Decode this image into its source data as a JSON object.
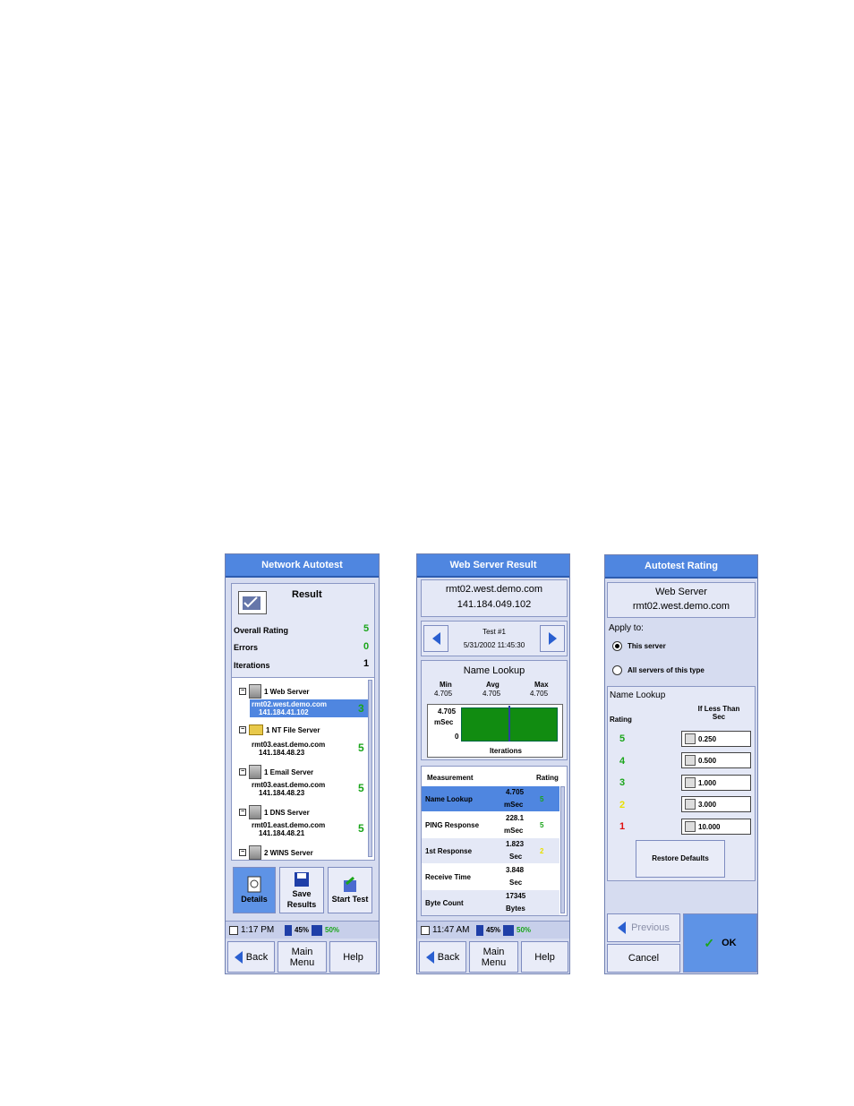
{
  "screen1": {
    "title": "Network Autotest",
    "result_label": "Result",
    "rows": [
      {
        "label": "Overall Rating",
        "value": "5"
      },
      {
        "label": "Errors",
        "value": "0"
      },
      {
        "label": "Iterations",
        "value": "1"
      }
    ],
    "tree": [
      {
        "group": "1 Web Server",
        "host": "rmt02.west.demo.com",
        "ip": "141.184.41.102",
        "rating": "3",
        "selected": true
      },
      {
        "group": "1 NT File Server",
        "host": "rmt03.east.demo.com",
        "ip": "141.184.48.23",
        "rating": "5"
      },
      {
        "group": "1 Email Server",
        "host": "rmt03.east.demo.com",
        "ip": "141.184.48.23",
        "rating": "5"
      },
      {
        "group": "1 DNS Server",
        "host": "rmt01.east.demo.com",
        "ip": "141.184.48.21",
        "rating": "5"
      },
      {
        "group": "2 WINS Server"
      }
    ],
    "buttons": {
      "details": "Details",
      "save": "Save Results",
      "start": "Start Test"
    },
    "status": {
      "time": "1:17 PM",
      "battery": "45%",
      "disk": "50%"
    },
    "nav": {
      "back": "Back",
      "main": "Main Menu",
      "help": "Help"
    }
  },
  "screen2": {
    "title": "Web Server Result",
    "host": "rmt02.west.demo.com",
    "ip": "141.184.049.102",
    "test_label": "Test #1",
    "test_date": "5/31/2002 11:45:30",
    "chart_title": "Name Lookup",
    "stats": [
      {
        "label": "Min",
        "value": "4.705"
      },
      {
        "label": "Avg",
        "value": "4.705"
      },
      {
        "label": "Max",
        "value": "4.705"
      }
    ],
    "y_value": "4.705",
    "y_unit": "mSec",
    "y_zero": "0",
    "x_label": "Iterations",
    "table_header": {
      "measurement": "Measurement",
      "rating": "Rating"
    },
    "measurements": [
      {
        "name": "Name Lookup",
        "value": "4.705",
        "unit": "mSec",
        "rating": "5"
      },
      {
        "name": "PING Response",
        "value": "228.1",
        "unit": "mSec",
        "rating": "5"
      },
      {
        "name": "1st Response",
        "value": "1.823",
        "unit": "Sec",
        "rating": "2"
      },
      {
        "name": "Receive Time",
        "value": "3.848",
        "unit": "Sec",
        "rating": ""
      },
      {
        "name": "Byte Count",
        "value": "17345",
        "unit": "Bytes",
        "rating": ""
      }
    ],
    "status": {
      "time": "11:47 AM",
      "battery": "45%",
      "disk": "50%"
    },
    "nav": {
      "back": "Back",
      "main": "Main Menu",
      "help": "Help"
    }
  },
  "screen3": {
    "title": "Autotest Rating",
    "server": "Web Server",
    "host": "rmt02.west.demo.com",
    "apply_label": "Apply to:",
    "option_this": "This server",
    "option_all": "All servers of this type",
    "section": "Name Lookup",
    "col_rating": "Rating",
    "col_threshold": "If Less Than Sec",
    "ratings": [
      {
        "rating": "5",
        "value": "0.250",
        "color": "#1aa51a"
      },
      {
        "rating": "4",
        "value": "0.500",
        "color": "#1aa51a"
      },
      {
        "rating": "3",
        "value": "1.000",
        "color": "#1aa51a"
      },
      {
        "rating": "2",
        "value": "3.000",
        "color": "#e8e000"
      },
      {
        "rating": "1",
        "value": "10.000",
        "color": "#e01010"
      }
    ],
    "restore": "Restore Defaults",
    "previous": "Previous",
    "ok": "OK",
    "cancel": "Cancel"
  }
}
